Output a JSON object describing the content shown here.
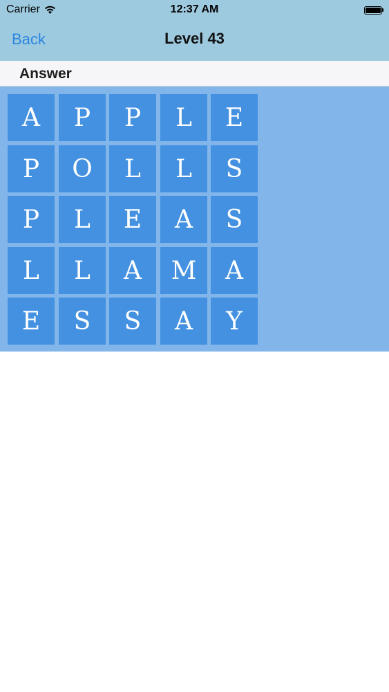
{
  "status_bar": {
    "carrier": "Carrier",
    "time": "12:37 AM",
    "wifi_icon": "wifi-icon",
    "battery_icon": "battery-icon"
  },
  "nav": {
    "back_label": "Back",
    "title": "Level 43"
  },
  "answer": {
    "label": "Answer"
  },
  "colors": {
    "nav_background": "#9ecadf",
    "board_background": "#82b6ea",
    "tile_background": "#4391e0",
    "tile_text": "#ffffff",
    "back_tint": "#2b86e0"
  },
  "grid": [
    [
      "A",
      "P",
      "P",
      "L",
      "E"
    ],
    [
      "P",
      "O",
      "L",
      "L",
      "S"
    ],
    [
      "P",
      "L",
      "E",
      "A",
      "S"
    ],
    [
      "L",
      "L",
      "A",
      "M",
      "A"
    ],
    [
      "E",
      "S",
      "S",
      "A",
      "Y"
    ]
  ]
}
